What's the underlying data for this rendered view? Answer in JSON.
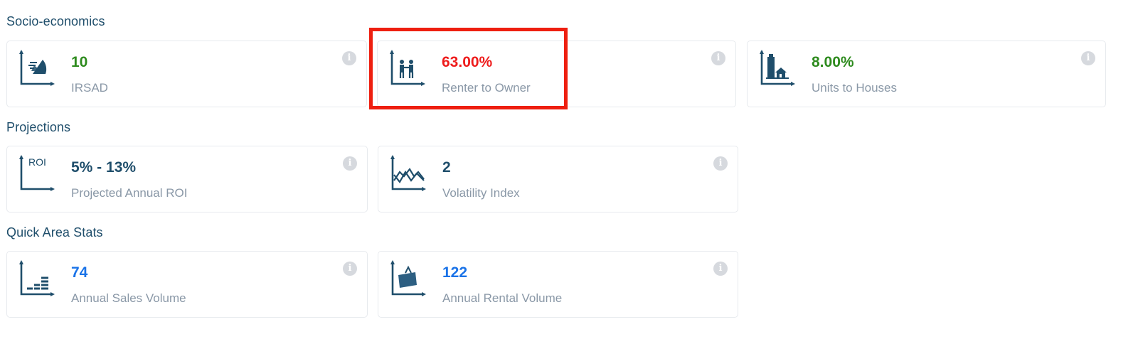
{
  "sections": {
    "socio": "Socio-economics",
    "projections": "Projections",
    "quick": "Quick Area Stats"
  },
  "colors": {
    "good": "#2e8b1e",
    "bad": "#ee1c1c",
    "neutral": "#1f4e6b",
    "count": "#1a73e8",
    "highlight": "#ee1f10"
  },
  "cards": {
    "irsad": {
      "value": "10",
      "label": "IRSAD",
      "icon": "irsad-chart-icon"
    },
    "renter_owner": {
      "value": "63.00%",
      "label": "Renter to Owner",
      "icon": "handshake-chart-icon"
    },
    "units_houses": {
      "value": "8.00%",
      "label": "Units to Houses",
      "icon": "buildings-chart-icon"
    },
    "roi": {
      "value": "5% - 13%",
      "label": "Projected Annual ROI",
      "icon": "roi-chart-icon",
      "icon_text": "ROI"
    },
    "volatility": {
      "value": "2",
      "label": "Volatility Index",
      "icon": "volatility-chart-icon"
    },
    "sales": {
      "value": "74",
      "label": "Annual Sales Volume",
      "icon": "sales-bars-icon"
    },
    "rental": {
      "value": "122",
      "label": "Annual Rental Volume",
      "icon": "rental-sign-icon"
    }
  },
  "info_glyph": "i"
}
